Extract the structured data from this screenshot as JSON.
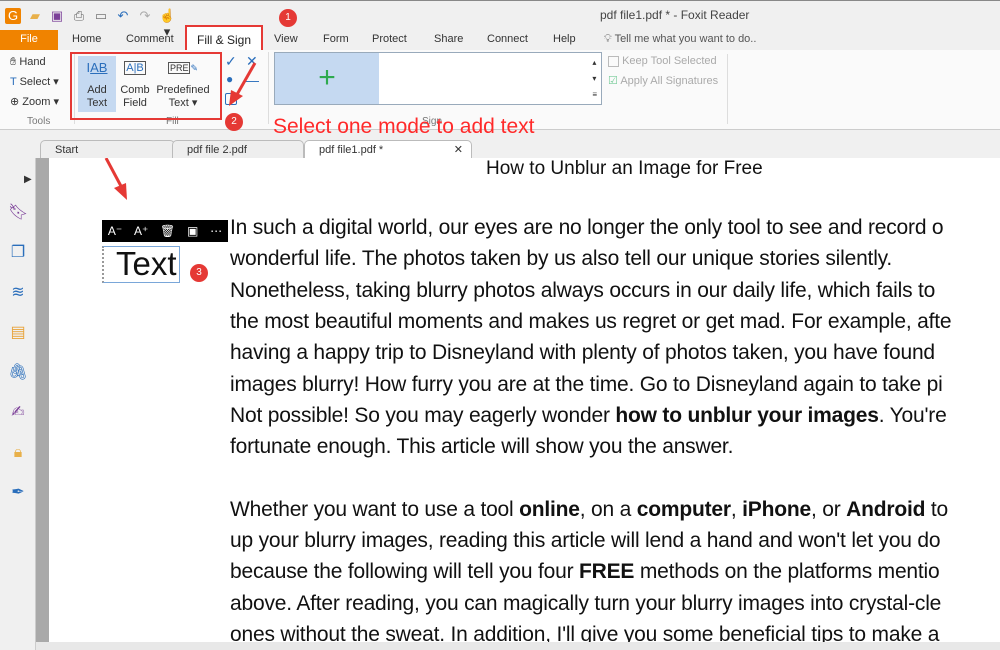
{
  "window": {
    "title": "pdf file1.pdf * - Foxit Reader"
  },
  "menu": {
    "tabs": [
      "File",
      "Home",
      "Comment",
      "Fill & Sign",
      "View",
      "Form",
      "Protect",
      "Share",
      "Connect",
      "Help"
    ],
    "tell_me": "Tell me what you want to do.."
  },
  "ribbon": {
    "tools": {
      "hand": "Hand",
      "select": "Select",
      "zoom": "Zoom",
      "label": "Tools"
    },
    "fill": {
      "add_text": [
        "Add",
        "Text"
      ],
      "comb_field": [
        "Comb",
        "Field"
      ],
      "predefined_text": [
        "Predefined",
        "Text"
      ],
      "label": "Fill"
    },
    "sign": {
      "label": "Sign"
    },
    "options": {
      "keep_tool": "Keep Tool Selected",
      "apply_all": "Apply All Signatures"
    }
  },
  "annotations": {
    "badges": [
      "1",
      "2",
      "3"
    ],
    "instruction": "Select one mode to add text",
    "color": "#e53935"
  },
  "doc_tabs": [
    "Start",
    "pdf file 2.pdf",
    "pdf file1.pdf *"
  ],
  "text_box": {
    "value": "Text"
  },
  "document": {
    "heading": "How to Unblur an Image for Free",
    "lines": [
      [
        [
          "In such a digital world, our eyes are no longer the only tool to see and record o",
          0
        ]
      ],
      [
        [
          "wonderful life. The photos taken by us also tell our unique stories silently.",
          0
        ]
      ],
      [
        [
          "Nonetheless, taking blurry photos always occurs in our daily life, which fails to",
          0
        ]
      ],
      [
        [
          "the most beautiful moments and makes us regret or get mad. For example, afte",
          0
        ]
      ],
      [
        [
          "having a happy trip to Disneyland with plenty of photos taken, you have found",
          0
        ]
      ],
      [
        [
          "images blurry! How furry you are at the time. Go to Disneyland again to take pi",
          0
        ]
      ],
      [
        [
          "Not possible! So you may eagerly wonder ",
          0
        ],
        [
          "how to unblur your images",
          1
        ],
        [
          ". You're",
          0
        ]
      ],
      [
        [
          "fortunate enough. This article will show you the answer.",
          0
        ]
      ],
      [],
      [
        [
          "Whether you want to use a tool ",
          0
        ],
        [
          "online",
          1
        ],
        [
          ", on a ",
          0
        ],
        [
          "computer",
          1
        ],
        [
          ", ",
          0
        ],
        [
          "iPhone",
          1
        ],
        [
          ", or ",
          0
        ],
        [
          "Android",
          1
        ],
        [
          " to",
          0
        ]
      ],
      [
        [
          "up your blurry images, reading this article will lend a hand and won't let you do",
          0
        ]
      ],
      [
        [
          "because the following will tell you four ",
          0
        ],
        [
          "FREE",
          1
        ],
        [
          " methods on the platforms mentio",
          0
        ]
      ],
      [
        [
          "above. After reading, you can magically turn your blurry images into crystal-cle",
          0
        ]
      ],
      [
        [
          "ones without the sweat. In addition, I'll give you some beneficial tips to make a",
          0
        ]
      ]
    ]
  }
}
